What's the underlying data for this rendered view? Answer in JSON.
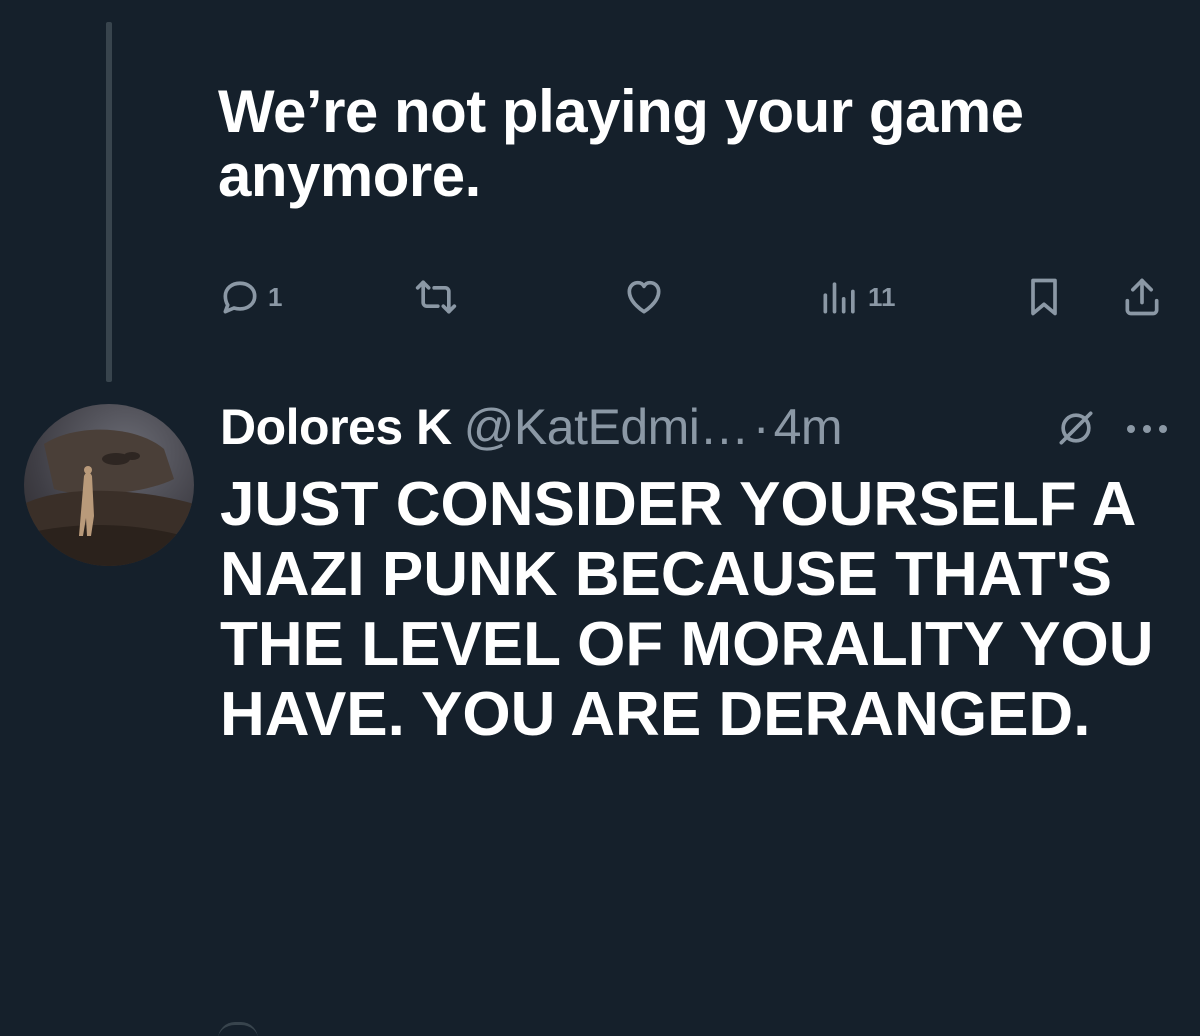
{
  "thread": {
    "first_tweet": {
      "text": "We’re not playing your game anymore.",
      "actions": {
        "reply": {
          "icon": "reply-icon",
          "count": "1"
        },
        "retweet": {
          "icon": "retweet-icon",
          "count": ""
        },
        "like": {
          "icon": "heart-icon",
          "count": ""
        },
        "views": {
          "icon": "views-icon",
          "count": "11"
        },
        "bookmark": {
          "icon": "bookmark-icon"
        },
        "share": {
          "icon": "share-icon"
        }
      }
    },
    "second_tweet": {
      "display_name": "Dolores K",
      "handle": "@KatEdmi…",
      "separator": "·",
      "time": "4m",
      "badge_icon": "grok-icon",
      "more_icon": "more-icon",
      "text": "JUST CONSIDER YOURSELF A NAZI PUNK BECAUSE THAT'S THE LEVEL OF MORALITY YOU HAVE. YOU ARE DERANGED."
    }
  },
  "colors": {
    "background": "#15202b",
    "text_primary": "#ffffff",
    "text_secondary": "#8b98a5",
    "thread_line": "#38444d"
  }
}
